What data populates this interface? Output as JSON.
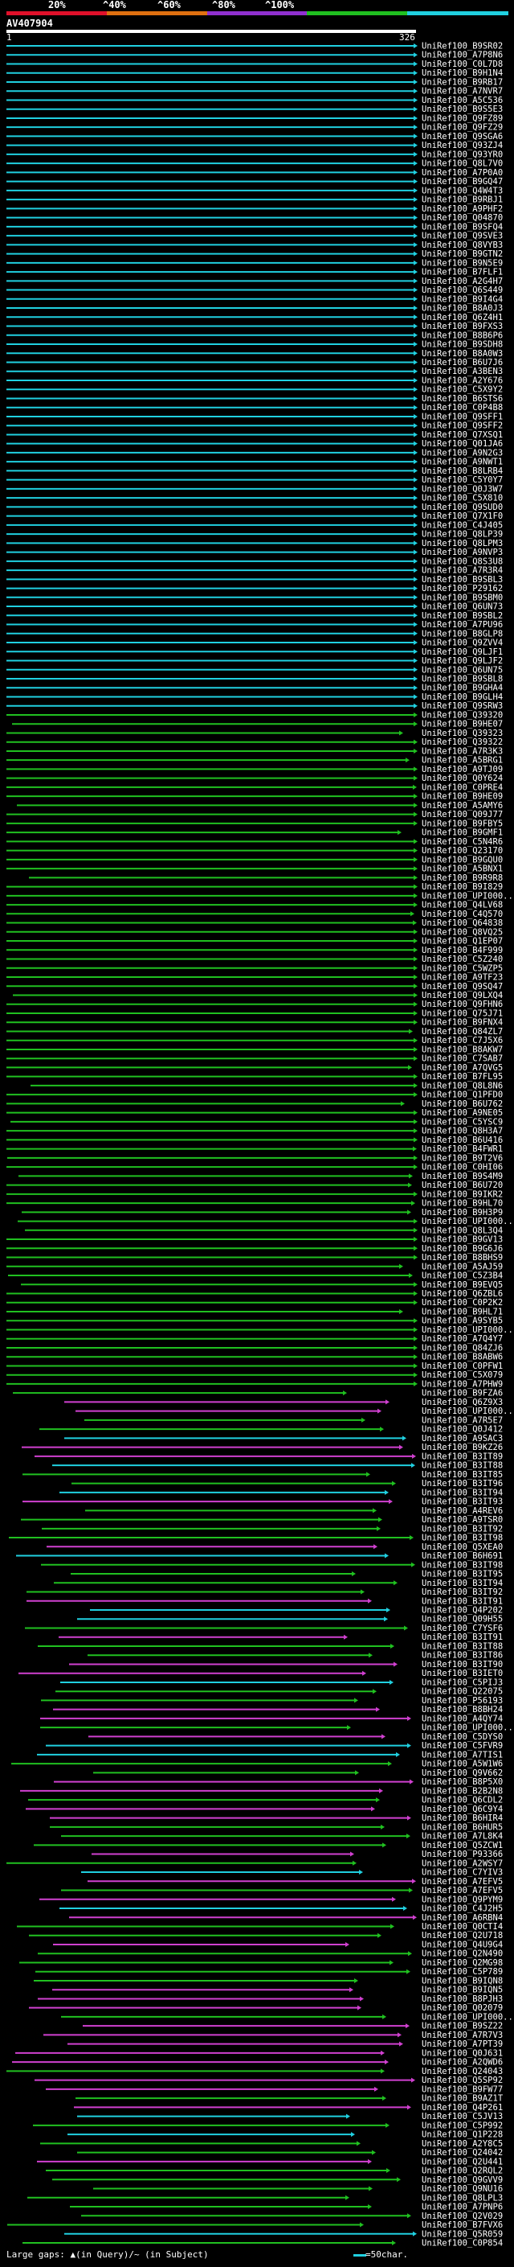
{
  "legend": {
    "labels": [
      "20%",
      "^40%",
      "^60%",
      "^80%",
      "^100%"
    ],
    "colors": [
      "#e0102a",
      "#e07010",
      "#9030d0",
      "#20c020",
      "#20d0e0"
    ]
  },
  "query": {
    "id": "AV407904",
    "start": "1",
    "end": "326"
  },
  "colors": {
    "cyan": "#20d0e0",
    "green": "#20c020",
    "magenta": "#d040d0",
    "white": "#ffffff"
  },
  "hits": [
    "UniRef100_B9SR02",
    "UniRef100_A7P8N6",
    "UniRef100_C0L7D8",
    "UniRef100_B9H1N4",
    "UniRef100_B9RB17",
    "UniRef100_A7NVR7",
    "UniRef100_A5C536",
    "UniRef100_B9S5E3",
    "UniRef100_Q9FZ89",
    "UniRef100_Q9FZ29",
    "UniRef100_Q9SGA6",
    "UniRef100_Q93ZJ4",
    "UniRef100_Q93YR0",
    "UniRef100_Q8L7V0",
    "UniRef100_A7P0A0",
    "UniRef100_B9GQ47",
    "UniRef100_Q4W4T3",
    "UniRef100_B9RBJ1",
    "UniRef100_A9PHF2",
    "UniRef100_Q04870",
    "UniRef100_B9SFQ4",
    "UniRef100_Q9SVE3",
    "UniRef100_Q8VYB3",
    "UniRef100_B9GTN2",
    "UniRef100_B9N5E9",
    "UniRef100_B7FLF1",
    "UniRef100_A2G4H7",
    "UniRef100_Q6S449",
    "UniRef100_B9I4G4",
    "UniRef100_B8A0J3",
    "UniRef100_Q6Z4H1",
    "UniRef100_B9FXS3",
    "UniRef100_B8B6P6",
    "UniRef100_B9SDH8",
    "UniRef100_B8A0W3",
    "UniRef100_B6U7J6",
    "UniRef100_A3BEN3",
    "UniRef100_A2Y676",
    "UniRef100_C5X9Y2",
    "UniRef100_B6STS6",
    "UniRef100_C0P4B8",
    "UniRef100_Q9SFF1",
    "UniRef100_Q9SFF2",
    "UniRef100_Q7XSQ1",
    "UniRef100_Q01JA6",
    "UniRef100_A9N2G3",
    "UniRef100_A9NWT1",
    "UniRef100_B8LRB4",
    "UniRef100_C5Y0Y7",
    "UniRef100_Q0J3W7",
    "UniRef100_C5X810",
    "UniRef100_Q9SUD0",
    "UniRef100_Q7X1F0",
    "UniRef100_C4J405",
    "UniRef100_Q8LP39",
    "UniRef100_Q8LPM3",
    "UniRef100_A9NVP3",
    "UniRef100_Q8S3U8",
    "UniRef100_A7R3R4",
    "UniRef100_B9SBL3",
    "UniRef100_P29162",
    "UniRef100_B9SBM0",
    "UniRef100_Q6UN73",
    "UniRef100_B9SBL2",
    "UniRef100_A7PU96",
    "UniRef100_B8GLP8",
    "UniRef100_Q9ZVV4",
    "UniRef100_Q9LJF1",
    "UniRef100_Q9LJF2",
    "UniRef100_Q6UN75",
    "UniRef100_B9SBL8",
    "UniRef100_B9GHA4",
    "UniRef100_B9GLH4",
    "UniRef100_Q9SRW3",
    "UniRef100_Q39320",
    "UniRef100_B9HE07",
    "UniRef100_Q39323",
    "UniRef100_Q39322",
    "UniRef100_A7R3K3",
    "UniRef100_A5BRG1",
    "UniRef100_A9TJ09",
    "UniRef100_Q0Y624",
    "UniRef100_C0PRE4",
    "UniRef100_B9HE09",
    "UniRef100_A5AMY6",
    "UniRef100_Q09J77",
    "UniRef100_B9FBY5",
    "UniRef100_B9GMF1",
    "UniRef100_C5N4R6",
    "UniRef100_Q23170",
    "UniRef100_B9GQU0",
    "UniRef100_A5BNX1",
    "UniRef100_B9R9R8",
    "UniRef100_B9I829",
    "UniRef100_UPI000...",
    "UniRef100_Q4LV68",
    "UniRef100_C4Q570",
    "UniRef100_Q64838",
    "UniRef100_Q8VQ25",
    "UniRef100_Q1EP07",
    "UniRef100_B4F999",
    "UniRef100_C5Z240",
    "UniRef100_C5WZP5",
    "UniRef100_A9TF23",
    "UniRef100_Q9SQ47",
    "UniRef100_Q9LXQ4",
    "UniRef100_Q9FHN6",
    "UniRef100_Q75J71",
    "UniRef100_B9FNX4",
    "UniRef100_Q84ZL7",
    "UniRef100_C7J5X6",
    "UniRef100_B8AKW7",
    "UniRef100_C7SAB7",
    "UniRef100_A7QVG5",
    "UniRef100_B7FL95",
    "UniRef100_Q8L8N6",
    "UniRef100_Q1PFD0",
    "UniRef100_B6U762",
    "UniRef100_A9NE05",
    "UniRef100_C5YSC9",
    "UniRef100_Q8H3A7",
    "UniRef100_B6U416",
    "UniRef100_B4FWR1",
    "UniRef100_B9T2V6",
    "UniRef100_C0HI06",
    "UniRef100_B9S4M9",
    "UniRef100_B6U720",
    "UniRef100_B9IKR2",
    "UniRef100_B9HL70",
    "UniRef100_B9H3P9",
    "UniRef100_UPI000...",
    "UniRef100_Q8L3Q4",
    "UniRef100_B9GV13",
    "UniRef100_B9G6J6",
    "UniRef100_B8BHS9",
    "UniRef100_A5AJ59",
    "UniRef100_C5Z3B4",
    "UniRef100_B9EVQ5",
    "UniRef100_Q6ZBL6",
    "UniRef100_C0P2K2",
    "UniRef100_B9HL71",
    "UniRef100_A9SYB5",
    "UniRef100_UPI000...",
    "UniRef100_A7Q4Y7",
    "UniRef100_Q84ZJ6",
    "UniRef100_B8ABW6",
    "UniRef100_C0PFW1",
    "UniRef100_C5X079",
    "UniRef100_A7PHW9",
    "UniRef100_B9FZA6",
    "UniRef100_Q6Z9X3",
    "UniRef100_UPI000...",
    "UniRef100_A7R5E7",
    "UniRef100_Q0J412",
    "UniRef100_A9SAC3",
    "UniRef100_B9KZ26",
    "UniRef100_B3IT89",
    "UniRef100_B3IT88",
    "UniRef100_B3IT85",
    "UniRef100_B3IT96",
    "UniRef100_B3IT94",
    "UniRef100_B3IT93",
    "UniRef100_A4REV6",
    "UniRef100_A9TSR0",
    "UniRef100_B3IT92",
    "UniRef100_B3IT98",
    "UniRef100_Q5XEA0",
    "UniRef100_B6H691",
    "UniRef100_B3IT98",
    "UniRef100_B3IT95",
    "UniRef100_B3IT94",
    "UniRef100_B3IT92",
    "UniRef100_B3IT91",
    "UniRef100_Q4P202",
    "UniRef100_Q09H55",
    "UniRef100_C7YSF6",
    "UniRef100_B3IT91",
    "UniRef100_B3IT88",
    "UniRef100_B3IT86",
    "UniRef100_B3IT90",
    "UniRef100_B3IET0",
    "UniRef100_C5PIJ3",
    "UniRef100_Q22075",
    "UniRef100_P56193",
    "UniRef100_B8BH24",
    "UniRef100_A4QY74",
    "UniRef100_UPI000...",
    "UniRef100_C5DYS0",
    "UniRef100_C5FVR9",
    "UniRef100_A7TIS1",
    "UniRef100_A5W1W6",
    "UniRef100_Q9V662",
    "UniRef100_B8P5X0",
    "UniRef100_B2B2N8",
    "UniRef100_Q6CDL2",
    "UniRef100_Q6C9Y4",
    "UniRef100_B6HIR4",
    "UniRef100_B6HUR5",
    "UniRef100_A7L8K4",
    "UniRef100_Q5ZCW1",
    "UniRef100_P93366",
    "UniRef100_A2WSY7",
    "UniRef100_C7YIV3",
    "UniRef100_A7EFV5",
    "UniRef100_A7EFV5",
    "UniRef100_Q9PYM9",
    "UniRef100_C4J2H5",
    "UniRef100_A6RBN4",
    "UniRef100_Q0CTI4",
    "UniRef100_Q2U718",
    "UniRef100_Q4U9G4",
    "UniRef100_Q2N490",
    "UniRef100_Q2MG98",
    "UniRef100_C5P789",
    "UniRef100_B9IQN8",
    "UniRef100_B9IQN5",
    "UniRef100_B8PJH3",
    "UniRef100_Q02079",
    "UniRef100_UPI000...",
    "UniRef100_B9SZ22",
    "UniRef100_A7R7V3",
    "UniRef100_A7PT39",
    "UniRef100_Q0J631",
    "UniRef100_A2QWD6",
    "UniRef100_Q24043",
    "UniRef100_Q5SP92",
    "UniRef100_B9FW77",
    "UniRef100_B9AZ1T",
    "UniRef100_Q4P261",
    "UniRef100_C5JV13",
    "UniRef100_C5P992",
    "UniRef100_Q1P228",
    "UniRef100_A2Y8C5",
    "UniRef100_Q24042",
    "UniRef100_Q2U441",
    "UniRef100_Q2RQL2",
    "UniRef100_Q9GVV9",
    "UniRef100_Q9NU16",
    "UniRef100_Q8LPL3",
    "UniRef100_A7PNP6",
    "UniRef100_Q2V029",
    "UniRef100_B7FVX6",
    "UniRef100_Q5R059",
    "UniRef100_C0P854"
  ],
  "footer": {
    "text": "Large gaps: ▲(in Query)/~ (in Subject)",
    "scale_text": "=50char."
  }
}
